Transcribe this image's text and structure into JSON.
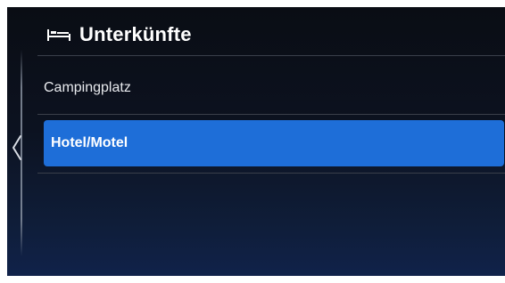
{
  "header": {
    "title": "Unterkünfte",
    "icon": "bed-icon"
  },
  "navigation": {
    "back_icon": "chevron-left-icon"
  },
  "list": {
    "items": [
      {
        "label": "Campingplatz",
        "selected": false
      },
      {
        "label": "Hotel/Motel",
        "selected": true
      }
    ]
  },
  "colors": {
    "accent": "#1e6ed8",
    "background_top": "#0a0d14",
    "background_bottom": "#10224a"
  }
}
